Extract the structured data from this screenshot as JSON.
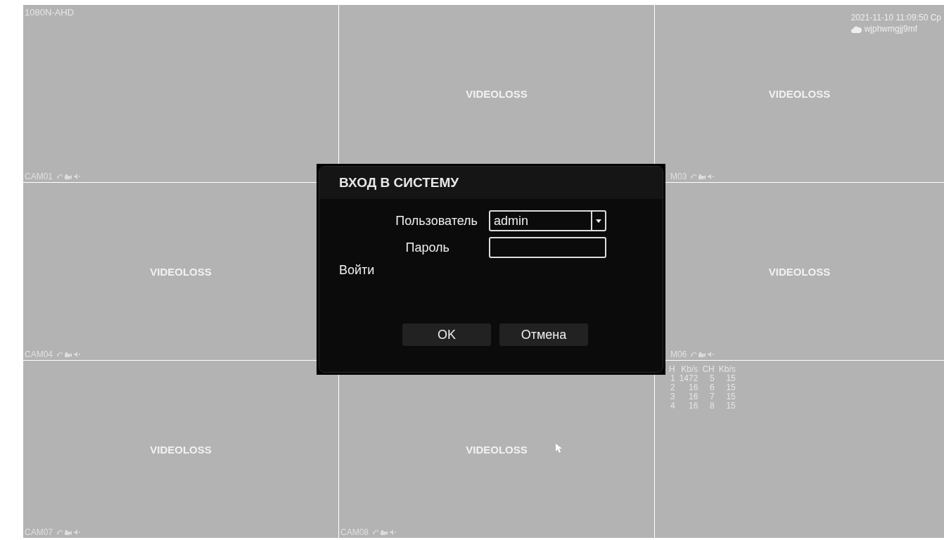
{
  "cells": [
    {
      "top_label": "1080N-AHD",
      "label": "CAM01"
    },
    {
      "status": "VIDEOLOSS"
    },
    {
      "status": "VIDEOLOSS",
      "label": "M03",
      "datetime": "2021-11-10 11:09:50 Ср",
      "cloud_id": "wjphwmgjj9mf"
    },
    {
      "status": "VIDEOLOSS",
      "label": "CAM04"
    },
    {},
    {
      "status": "VIDEOLOSS",
      "label": "M06"
    },
    {
      "status": "VIDEOLOSS",
      "label": "CAM07"
    },
    {
      "status": "VIDEOLOSS",
      "label": "CAM08",
      "cursor": true
    },
    {
      "bitrate_table": {
        "columns": [
          "H",
          "Kb/s",
          "CH",
          "Kb/s"
        ],
        "rows": [
          [
            "1",
            "1472",
            "5",
            "15"
          ],
          [
            "2",
            "16",
            "6",
            "15"
          ],
          [
            "3",
            "16",
            "7",
            "15"
          ],
          [
            "4",
            "16",
            "8",
            "15"
          ]
        ]
      }
    }
  ],
  "dialog": {
    "title": "ВХОД В СИСТЕМУ",
    "user_label": "Пользователь",
    "user_value": "admin",
    "password_label": "Пароль",
    "login_label": "Войти",
    "buttons": [
      "OK",
      "Отмена"
    ]
  }
}
